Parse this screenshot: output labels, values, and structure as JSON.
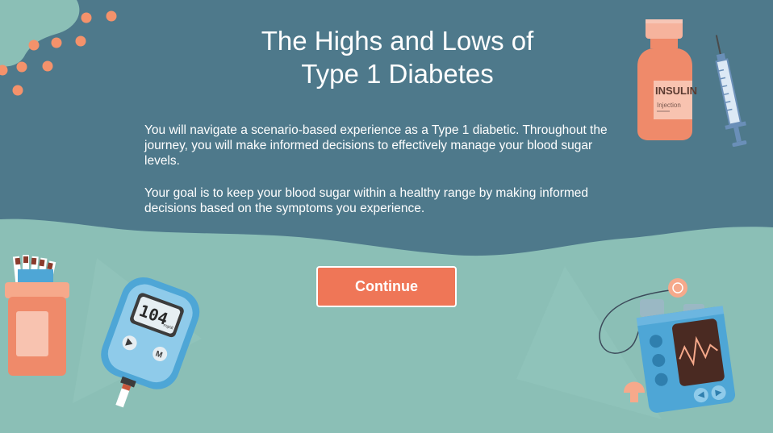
{
  "title": {
    "line1": "The Highs and Lows of",
    "line2": "Type 1 Diabetes"
  },
  "intro": {
    "paragraph1": "You will navigate a scenario-based experience as a Type 1 diabetic. Throughout the\njourney, you will make informed decisions to effectively manage your blood sugar\nlevels.",
    "paragraph2": " Your goal is to keep your blood sugar within a healthy range by making informed\ndecisions based on the symptoms you experience."
  },
  "continue_label": "Continue",
  "insulin_bottle": {
    "label": "INSULIN",
    "sublabel": "Injection"
  },
  "glucose_meter": {
    "reading": "104",
    "unit": "mg/dl",
    "button_label": "M"
  },
  "colors": {
    "top_band": "#4e798b",
    "background": "#8bbfb6",
    "accent": "#ef7657",
    "dots": "#f4926b"
  },
  "icons": [
    "insulin-bottle-icon",
    "syringe-icon",
    "test-strip-jar-icon",
    "glucose-meter-icon",
    "insulin-pump-icon",
    "decorative-dots-icon"
  ]
}
